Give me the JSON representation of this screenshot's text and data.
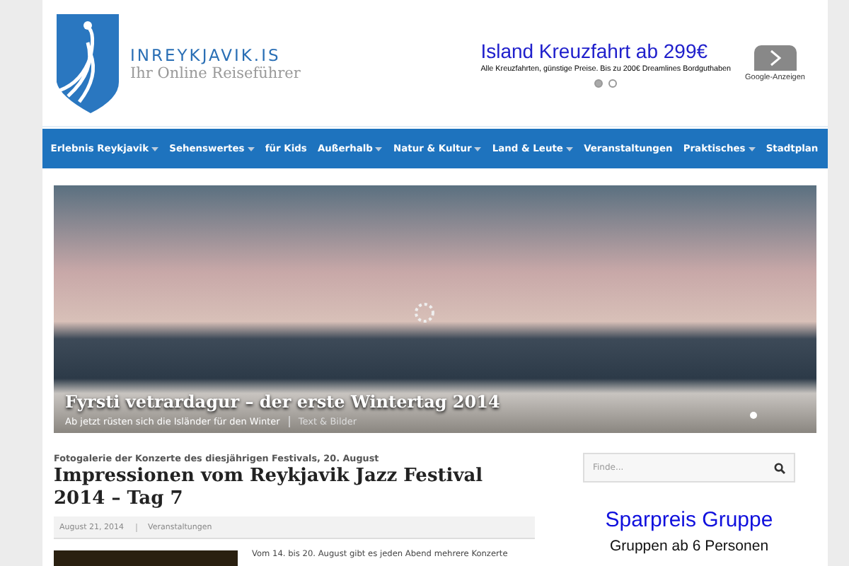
{
  "logo": {
    "name": "INREYKJAVIK.IS",
    "tagline": "Ihr Online Reiseführer"
  },
  "ad": {
    "title": "Island Kreuzfahrt ab 299€",
    "text": "Alle Kreuzfahrten, günstige Preise. Bis zu 200€ Dreamlines Bordguthaben",
    "label": "Google-Anzeigen",
    "dots": [
      {
        "selected": true
      },
      {
        "selected": false
      }
    ]
  },
  "nav": [
    {
      "label": "Erlebnis Reykjavik",
      "dropdown": true
    },
    {
      "label": "Sehenswertes",
      "dropdown": true
    },
    {
      "label": "für Kids",
      "dropdown": false
    },
    {
      "label": "Außerhalb",
      "dropdown": true
    },
    {
      "label": "Natur & Kultur",
      "dropdown": true
    },
    {
      "label": "Land & Leute",
      "dropdown": true
    },
    {
      "label": "Veranstaltungen",
      "dropdown": false
    },
    {
      "label": "Praktisches",
      "dropdown": true
    },
    {
      "label": "Stadtplan",
      "dropdown": false
    }
  ],
  "slider": {
    "title": "Fyrsti vetrardagur – der erste Wintertag 2014",
    "subtitle": "Ab jetzt rüsten sich die Isländer für den Winter",
    "link": "Text & Bilder"
  },
  "post": {
    "kicker": "Fotogalerie der Konzerte des diesjährigen Festivals, 20. August",
    "title": "Impressionen vom Reykjavik Jazz Festival 2014 – Tag 7",
    "date": "August 21, 2014",
    "category": "Veranstaltungen",
    "excerpt": "Vom 14. bis 20. August gibt es jeden Abend mehrere Konzerte"
  },
  "sidebar": {
    "search_placeholder": "Finde...",
    "ad_title": "Sparpreis Gruppe",
    "ad_text": "Gruppen ab 6 Personen"
  }
}
